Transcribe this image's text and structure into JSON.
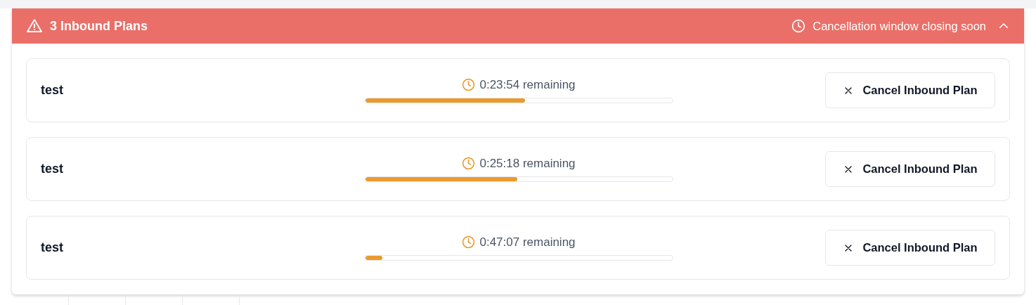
{
  "banner": {
    "title": "3 Inbound Plans",
    "notice": "Cancellation window closing soon",
    "expanded": true
  },
  "plans": [
    {
      "name": "test",
      "remaining": "0:23:54 remaining",
      "level": 0.52,
      "action": "Cancel Inbound Plan"
    },
    {
      "name": "test",
      "remaining": "0:25:18 remaining",
      "level": 0.495,
      "action": "Cancel Inbound Plan"
    },
    {
      "name": "test",
      "remaining": "0:47:07 remaining",
      "level": 0.057,
      "action": "Cancel Inbound Plan"
    }
  ]
}
